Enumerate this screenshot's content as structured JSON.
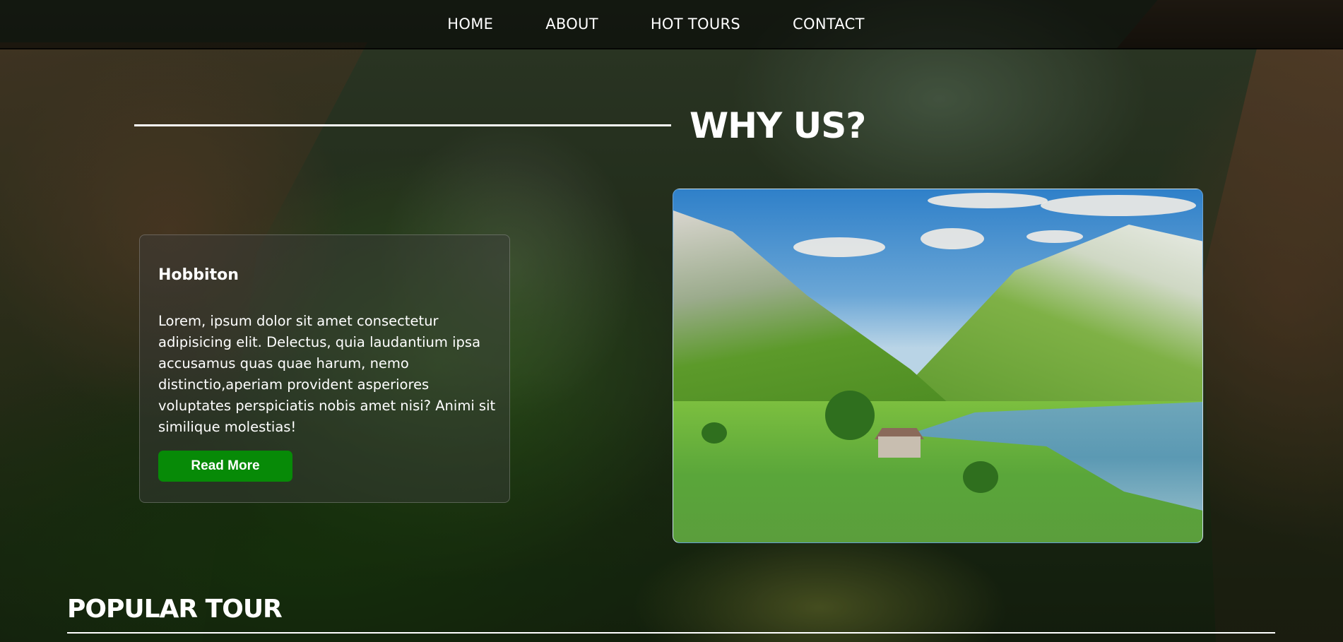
{
  "nav": {
    "items": [
      {
        "label": "HOME"
      },
      {
        "label": "ABOUT"
      },
      {
        "label": "HOT TOURS"
      },
      {
        "label": "CONTACT"
      }
    ]
  },
  "why_us": {
    "title": "WHY US?"
  },
  "card": {
    "title": "Hobbiton",
    "text": "Lorem, ipsum dolor sit amet consectetur adipisicing elit. Delectus, quia laudantium ipsa accusamus quas quae harum, nemo distinctio,aperiam provident asperiores voluptates perspiciatis nobis amet nisi? Animi sit similique molestias!",
    "button_label": "Read More"
  },
  "popular": {
    "title": "POPULAR TOUR"
  },
  "colors": {
    "button": "#078a07",
    "text": "#ffffff",
    "nav_bg": "rgba(0,0,0,0.55)"
  },
  "icons": {
    "background": "mountain-canyon-background-image",
    "photo": "mountain-lake-landscape-image"
  }
}
